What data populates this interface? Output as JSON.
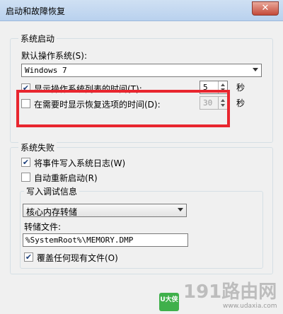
{
  "window": {
    "title": "启动和故障恢复",
    "close_symbol": "✕"
  },
  "system_startup": {
    "group_label": "系统启动",
    "default_os_label": "默认操作系统(S):",
    "default_os_value": "Windows 7",
    "show_list_label": "显示操作系统列表的时间(T):",
    "show_list_checked": true,
    "show_list_value": "5",
    "show_list_unit": "秒",
    "show_recovery_label": "在需要时显示恢复选项的时间(D):",
    "show_recovery_checked": false,
    "show_recovery_value": "30",
    "show_recovery_unit": "秒"
  },
  "system_failure": {
    "group_label": "系统失败",
    "write_event_label": "将事件写入系统日志(W)",
    "write_event_checked": true,
    "auto_restart_label": "自动重新启动(R)",
    "auto_restart_checked": false,
    "debug_info": {
      "group_label": "写入调试信息",
      "dump_type_value": "核心内存转储",
      "dump_file_label": "转储文件:",
      "dump_file_value": "%SystemRoot%\\MEMORY.DMP",
      "overwrite_label": "覆盖任何现有文件(O)",
      "overwrite_checked": true
    }
  },
  "watermark": {
    "logo_text": "U大侠",
    "main_text": "191路由网",
    "sub_text": "www.udaxia.com"
  },
  "colors": {
    "highlight": "#e8262f",
    "titlebar": "#b9d1ee"
  }
}
